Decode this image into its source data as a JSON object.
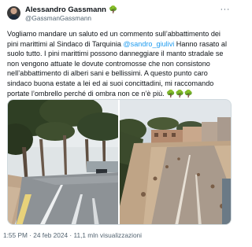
{
  "author": {
    "display_name": "Alessandro Gassmann",
    "handle": "@GassmanGassmann",
    "badge_icon": "deciduous-tree-icon",
    "badge_glyph": "🌳"
  },
  "header": {
    "more_glyph": "···"
  },
  "tweet": {
    "text_before_mention": "Vogliamo mandare un saluto ed un commento sull’abbattimento dei pini marittimi al Sindaco di Tarquinia ",
    "mention": "@sandro_giulivi",
    "text_after_mention": " Hanno rasato al suolo tutto. I pini marittimi possono danneggiare il manto stradale se non vengono attuate le dovute contromosse che non consistono nell’abbattimento di alberi sani e bellissimi. A questo punto caro sindaco buona estate a lei ed ai suoi concittadini, mi raccomando portate l’ombrello perché di ombra non ce n’è più. ",
    "trailing_emoji": "🌳🌳🌳"
  },
  "media": {
    "left_photo_icon": "photo-street-with-pine-trees",
    "right_photo_icon": "photo-street-with-felled-trees"
  },
  "footer": {
    "meta": "1:55 PM · 24 feb 2024 · 11,1 mln visualizzazioni"
  },
  "colors": {
    "link": "#1d9bf0",
    "secondary_text": "#536471",
    "badge_green": "#2f7d32"
  }
}
